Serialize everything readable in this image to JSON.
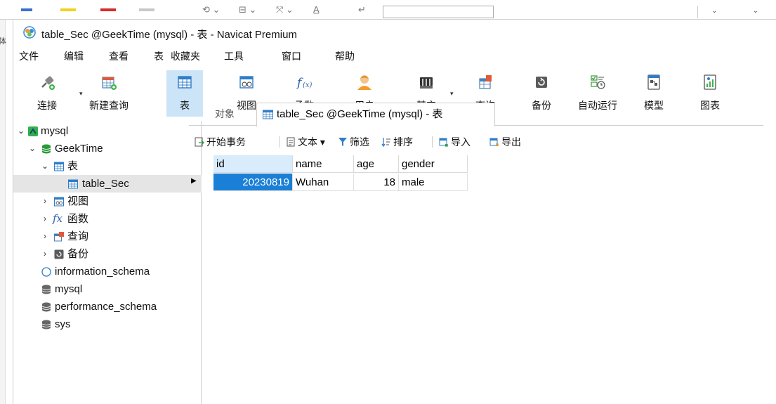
{
  "window": {
    "title": "table_Sec @GeekTime (mysql) - 表 - Navicat Premium"
  },
  "background": {
    "left_edge_text": "体"
  },
  "menu": [
    "文件",
    "编辑",
    "查看",
    "表",
    "收藏夹",
    "工具",
    "窗口",
    "帮助"
  ],
  "toolbar": [
    {
      "label": "连接",
      "icon": "plug-icon"
    },
    {
      "label": "新建查询",
      "icon": "new-query-icon"
    },
    {
      "label": "表",
      "icon": "table-icon"
    },
    {
      "label": "视图",
      "icon": "view-icon"
    },
    {
      "label": "函数",
      "icon": "function-icon"
    },
    {
      "label": "用户",
      "icon": "user-icon"
    },
    {
      "label": "其它",
      "icon": "tools-icon"
    },
    {
      "label": "查询",
      "icon": "query-icon"
    },
    {
      "label": "备份",
      "icon": "backup-icon"
    },
    {
      "label": "自动运行",
      "icon": "schedule-icon"
    },
    {
      "label": "模型",
      "icon": "model-icon"
    },
    {
      "label": "图表",
      "icon": "chart-icon"
    }
  ],
  "navigator": {
    "connection": "mysql",
    "database": "GeekTime",
    "tables_group": "表",
    "selected_table": "table_Sec",
    "groups": [
      "视图",
      "函数",
      "查询",
      "备份"
    ],
    "other_databases": [
      "information_schema",
      "mysql",
      "performance_schema",
      "sys"
    ]
  },
  "tabs": {
    "objects": "对象",
    "active": "table_Sec @GeekTime (mysql) - 表"
  },
  "subtoolbar": {
    "begin_transaction": "开始事务",
    "text": "文本",
    "filter": "筛选",
    "sort": "排序",
    "import": "导入",
    "export": "导出"
  },
  "grid": {
    "columns": [
      "id",
      "name",
      "age",
      "gender"
    ],
    "rows": [
      [
        "20230819",
        "Wuhan",
        "18",
        "male"
      ]
    ]
  },
  "colors": {
    "selection_blue": "#1a7fd6",
    "active_tool_bg": "#cce4f7",
    "nav_selected_bg": "#e5e5e5"
  }
}
